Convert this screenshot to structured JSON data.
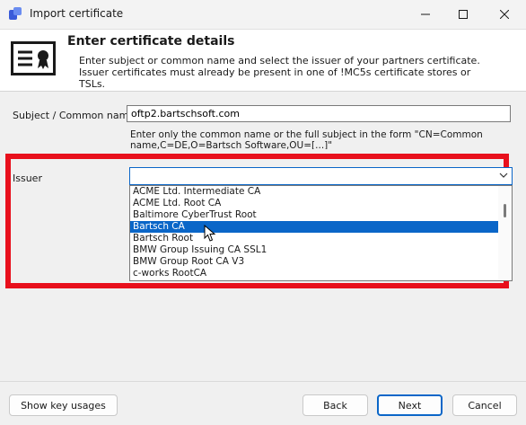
{
  "window": {
    "title": "Import certificate"
  },
  "header": {
    "title": "Enter certificate details",
    "description": "Enter subject or common name and select the issuer of your partners certificate. Issuer certificates must already be present in one of !MC5s certificate stores or TSLs."
  },
  "form": {
    "subject_label": "Subject / Common name",
    "subject_value": "oftp2.bartschsoft.com",
    "hint": "Enter only the common name or the full subject in the form \"CN=Common name,C=DE,O=Bartsch Software,OU=[...]\"",
    "issuer_label": "Issuer",
    "issuer_value": "",
    "issuer_options": [
      "ACME Ltd. Intermediate CA",
      "ACME Ltd. Root CA",
      "Baltimore CyberTrust Root",
      "Bartsch CA",
      "Bartsch Root",
      "BMW Group Issuing CA SSL1",
      "BMW Group Root CA V3",
      "c-works RootCA"
    ],
    "highlighted_option": "Bartsch CA"
  },
  "footer": {
    "show_key_usages": "Show key usages",
    "back": "Back",
    "next": "Next",
    "cancel": "Cancel"
  },
  "colors": {
    "accent": "#0a66c8",
    "highlight_box": "#e8101c"
  }
}
